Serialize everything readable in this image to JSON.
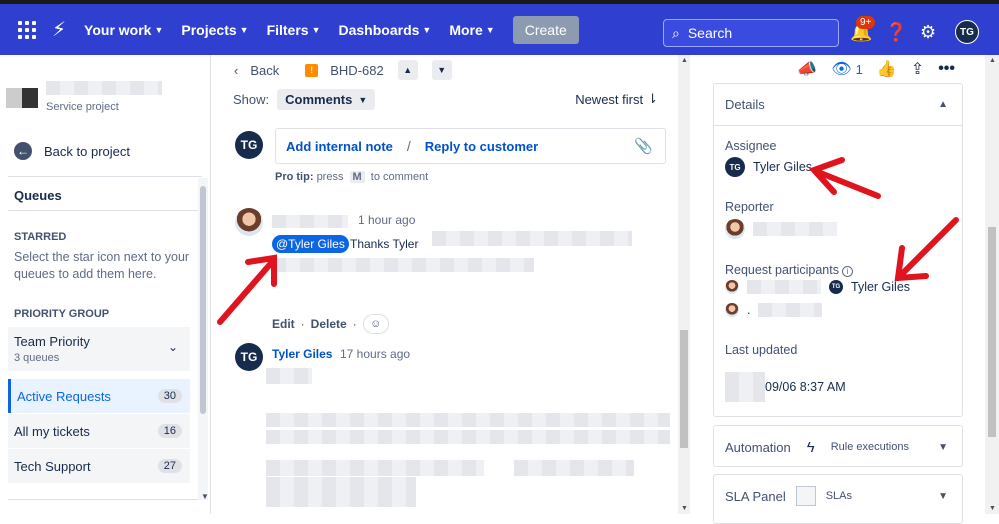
{
  "topnav": {
    "items": [
      {
        "label": "Your work"
      },
      {
        "label": "Projects"
      },
      {
        "label": "Filters"
      },
      {
        "label": "Dashboards"
      },
      {
        "label": "More"
      }
    ],
    "create_label": "Create",
    "search_placeholder": "Search",
    "notifications_badge": "9+",
    "user_initials": "TG"
  },
  "sidebar": {
    "project_subtitle": "Service project",
    "back_label": "Back to project",
    "queues_title": "Queues",
    "starred_heading": "STARRED",
    "starred_text": "Select the star icon next to your queues to add them here.",
    "priority_heading": "PRIORITY GROUP",
    "group": {
      "title": "Team Priority",
      "subtitle": "3 queues"
    },
    "queues": [
      {
        "label": "Active Requests",
        "count": "30"
      },
      {
        "label": "All my tickets",
        "count": "16"
      },
      {
        "label": "Tech Support",
        "count": "27"
      }
    ]
  },
  "main": {
    "back_label": "Back",
    "issue_key": "BHD-682",
    "show_label": "Show:",
    "filter_value": "Comments",
    "sort_label": "Newest first",
    "composer_initials": "TG",
    "add_internal_note": "Add internal note",
    "divider": "/",
    "reply_to_customer": "Reply to customer",
    "protip": {
      "label": "Pro tip:",
      "press": "press",
      "key": "M",
      "suffix": "to comment"
    },
    "comment1": {
      "time": "1 hour ago",
      "mention": "@Tyler Giles",
      "text": "Thanks Tyler"
    },
    "actions": {
      "edit": "Edit",
      "sep1": "·",
      "delete": "Delete",
      "sep2": "·"
    },
    "comment2": {
      "initials": "TG",
      "author": "Tyler Giles",
      "time": "17 hours ago"
    }
  },
  "details": {
    "watchers_count": "1",
    "panel_title": "Details",
    "assignee_label": "Assignee",
    "assignee_initials": "TG",
    "assignee_name": "Tyler Giles",
    "reporter_label": "Reporter",
    "participants_label": "Request participants",
    "participant_initials": "TG",
    "participant_name": "Tyler Giles",
    "participant3_initial": ".",
    "last_updated_label": "Last updated",
    "last_updated_value": "09/06 8:37 AM",
    "automation_label": "Automation",
    "automation_sub": "Rule executions",
    "sla_label": "SLA Panel",
    "sla_sub": "SLAs"
  },
  "colors": {
    "nav_bg": "#2f3fcf",
    "accent": "#0c66e4",
    "annotation": "#e0141e"
  }
}
